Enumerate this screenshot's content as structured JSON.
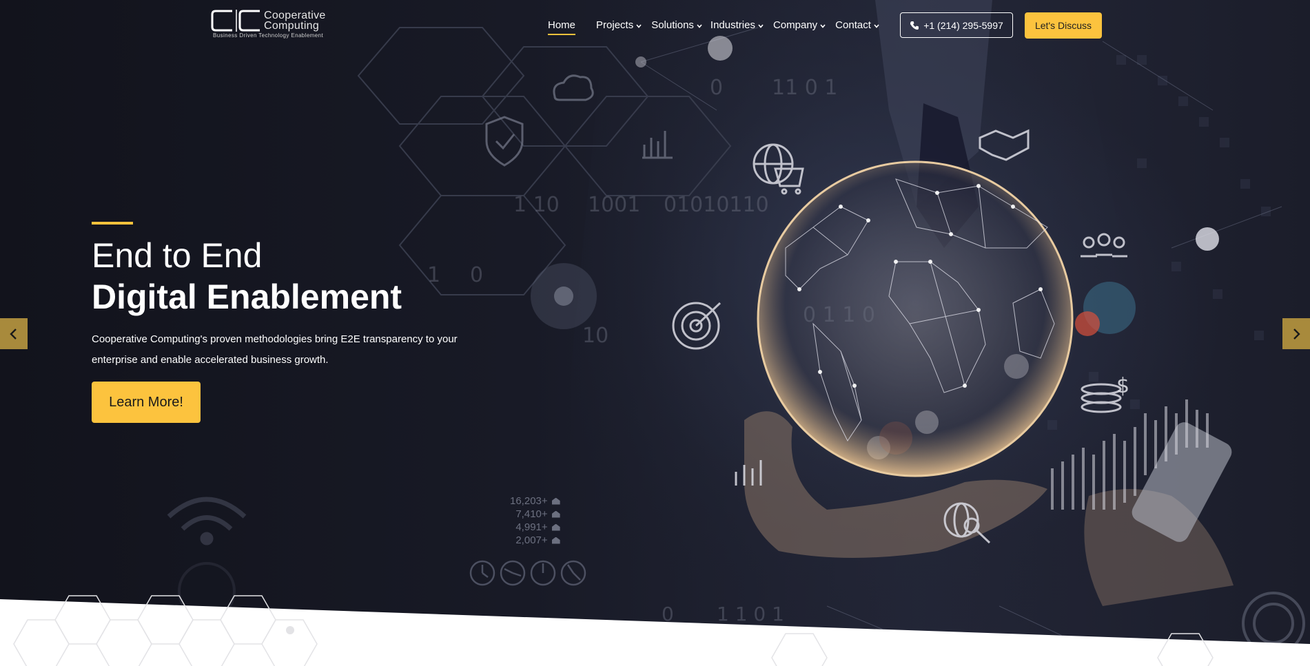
{
  "brand": {
    "name_line1": "Cooperative",
    "name_line2": "Computing",
    "tagline": "Business Driven Technology Enablement"
  },
  "nav": {
    "items": [
      {
        "label": "Home",
        "active": true,
        "dropdown": false
      },
      {
        "label": "Projects",
        "dropdown": true
      },
      {
        "label": "Solutions",
        "dropdown": true
      },
      {
        "label": "Industries",
        "dropdown": true
      },
      {
        "label": "Company",
        "dropdown": true
      },
      {
        "label": "Contact",
        "dropdown": true
      }
    ],
    "phone": "+1 (214) 295-5997",
    "cta": "Let's Discuss"
  },
  "hero": {
    "title_line1": "End to End",
    "title_line2": "Digital Enablement",
    "subtitle": "Cooperative Computing's proven methodologies bring E2E transparency to your enterprise and enable accelerated business growth.",
    "button": "Learn More!",
    "prev_icon": "chevron-left-icon",
    "next_icon": "chevron-right-icon"
  },
  "background_text": {
    "binary": [
      "0",
      "11 0 1",
      "1 10",
      "1001",
      "01010110",
      "1",
      "0",
      "10",
      "0 1 1 0",
      "0",
      "1 1 0 1"
    ],
    "stats": [
      "16,203+",
      "7,410+",
      "4,991+",
      "2,007+"
    ]
  },
  "colors": {
    "accent": "#fcc33e",
    "hero_bg": "#181a26",
    "arrow_bg": "#a88a3c"
  }
}
